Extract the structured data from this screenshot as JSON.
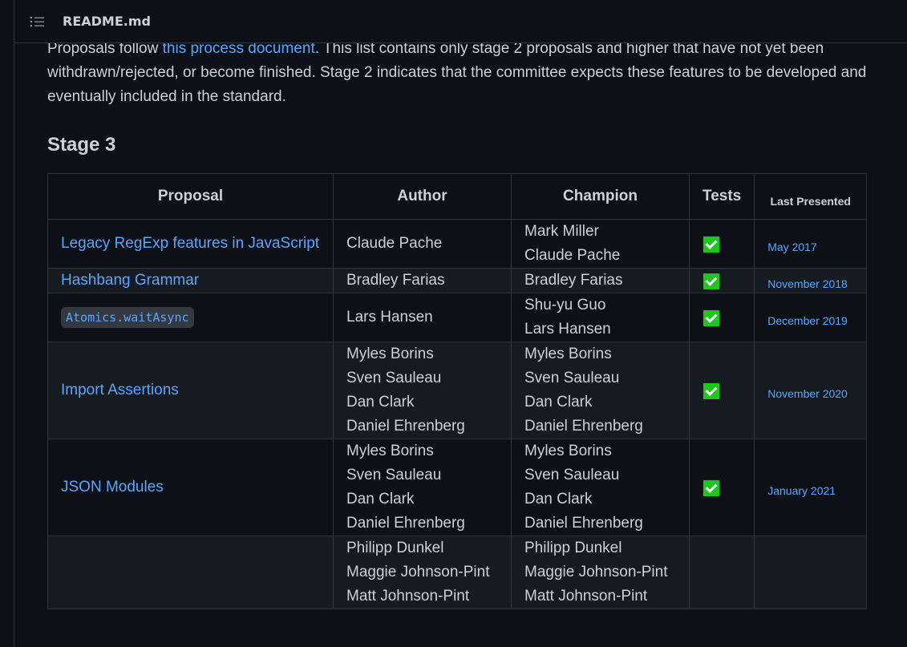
{
  "header": {
    "toc_icon": "list-unordered-icon",
    "file_name": "README.md"
  },
  "intro": {
    "before_link": "Proposals follow ",
    "link_text": "this process document",
    "after_link": ". This list contains only stage 2 proposals and higher that have not yet been withdrawn/rejected, or become finished. Stage 2 indicates that the committee expects these features to be developed and eventually included in the standard."
  },
  "stage_heading": "Stage 3",
  "table": {
    "headers": {
      "proposal": "Proposal",
      "author": "Author",
      "champion": "Champion",
      "tests": "Tests",
      "last_presented": "Last Presented"
    },
    "test_icon": "white-check-mark-icon",
    "rows": [
      {
        "proposal": "Legacy RegExp features in JavaScript",
        "proposal_is_code": false,
        "authors": [
          "Claude Pache"
        ],
        "champions": [
          "Mark Miller",
          "Claude Pache"
        ],
        "tests": true,
        "last_presented": "May 2017"
      },
      {
        "proposal": "Hashbang Grammar",
        "proposal_is_code": false,
        "authors": [
          "Bradley Farias"
        ],
        "champions": [
          "Bradley Farias"
        ],
        "tests": true,
        "last_presented": "November 2018"
      },
      {
        "proposal": "Atomics.waitAsync",
        "proposal_is_code": true,
        "authors": [
          "Lars Hansen"
        ],
        "champions": [
          "Shu-yu Guo",
          "Lars Hansen"
        ],
        "tests": true,
        "last_presented": "December 2019"
      },
      {
        "proposal": "Import Assertions",
        "proposal_is_code": false,
        "authors": [
          "Myles Borins",
          "Sven Sauleau",
          "Dan Clark",
          "Daniel Ehrenberg"
        ],
        "champions": [
          "Myles Borins",
          "Sven Sauleau",
          "Dan Clark",
          "Daniel Ehrenberg"
        ],
        "tests": true,
        "last_presented": "November 2020"
      },
      {
        "proposal": "JSON Modules",
        "proposal_is_code": false,
        "authors": [
          "Myles Borins",
          "Sven Sauleau",
          "Dan Clark",
          "Daniel Ehrenberg"
        ],
        "champions": [
          "Myles Borins",
          "Sven Sauleau",
          "Dan Clark",
          "Daniel Ehrenberg"
        ],
        "tests": true,
        "last_presented": "January 2021"
      },
      {
        "proposal": "",
        "proposal_is_code": false,
        "authors": [
          "Philipp Dunkel",
          "Maggie Johnson-Pint",
          "Matt Johnson-Pint"
        ],
        "champions": [
          "Philipp Dunkel",
          "Maggie Johnson-Pint",
          "Matt Johnson-Pint"
        ],
        "tests": false,
        "last_presented": ""
      }
    ]
  }
}
